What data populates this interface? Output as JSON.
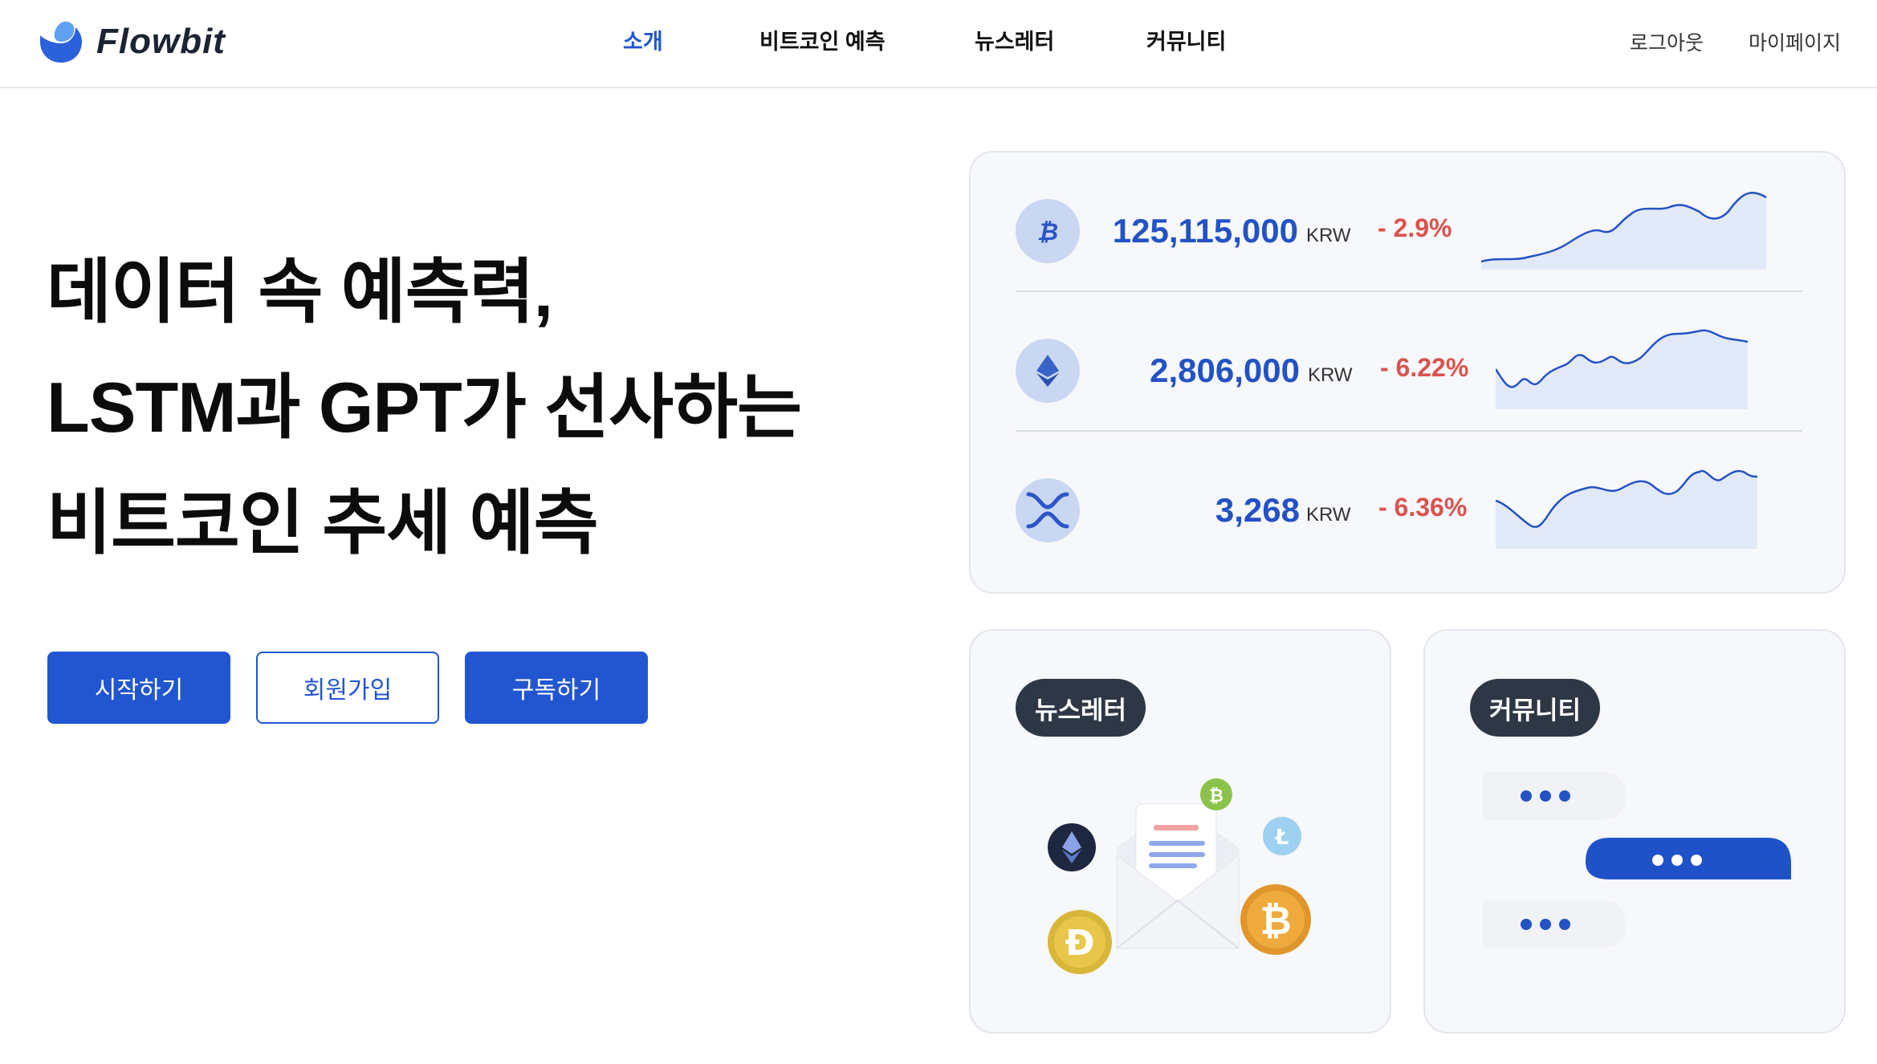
{
  "header": {
    "logo_text": "Flowbit",
    "nav": [
      {
        "label": "소개",
        "active": true
      },
      {
        "label": "비트코인 예측",
        "active": false
      },
      {
        "label": "뉴스레터",
        "active": false
      },
      {
        "label": "커뮤니티",
        "active": false
      }
    ],
    "user_links": {
      "logout": "로그아웃",
      "mypage": "마이페이지"
    }
  },
  "hero": {
    "title_lines": [
      "데이터 속 예측력,",
      "LSTM과 GPT가 선사하는",
      "비트코인 추세 예측"
    ],
    "buttons": {
      "start": "시작하기",
      "signup": "회원가입",
      "subscribe": "구독하기"
    }
  },
  "prices": [
    {
      "coin": "bitcoin",
      "icon": "bitcoin-icon",
      "price": "125,115,000",
      "unit": "KRW",
      "change": "- 2.9%"
    },
    {
      "coin": "ethereum",
      "icon": "ethereum-icon",
      "price": "2,806,000",
      "unit": "KRW",
      "change": "- 6.22%"
    },
    {
      "coin": "ripple",
      "icon": "ripple-icon",
      "price": "3,268",
      "unit": "KRW",
      "change": "- 6.36%"
    }
  ],
  "cards": {
    "newsletter": {
      "label": "뉴스레터",
      "illustration": "envelope-with-coins"
    },
    "community": {
      "label": "커뮤니티",
      "illustration": "chat-bubbles"
    }
  },
  "colors": {
    "accent": "#2256d0",
    "negative": "#d9534f",
    "dark_pill": "#2e3746"
  }
}
